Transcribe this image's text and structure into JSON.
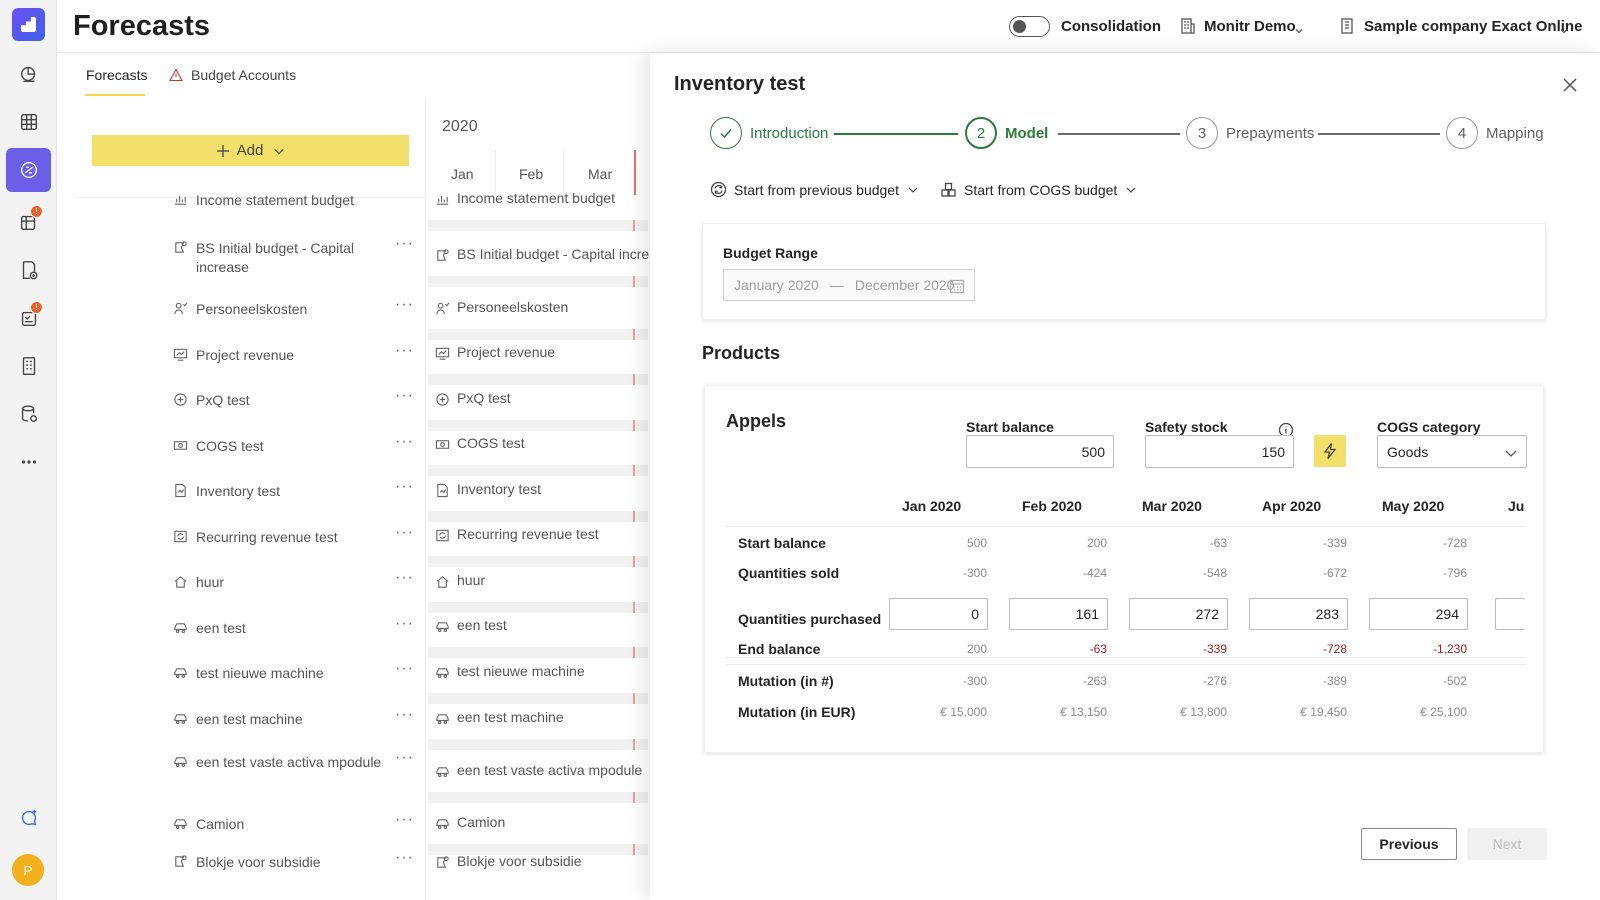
{
  "header": {
    "title": "Forecasts",
    "consolidation_label": "Consolidation",
    "org_label": "Monitr Demo",
    "company_label": "Sample company Exact Online"
  },
  "rail": {
    "avatar_initial": "P",
    "icons": [
      "dashboard-icon",
      "grid-icon",
      "forecast-icon",
      "budget-sheet-icon",
      "report-add-icon",
      "tasks-icon",
      "building-icon",
      "database-icon",
      "more-icon",
      "chat-sparkle-icon"
    ]
  },
  "tabs": {
    "forecasts": "Forecasts",
    "budget_accounts": "Budget Accounts"
  },
  "add_label": "Add",
  "grid": {
    "year": "2020",
    "months": [
      "Jan",
      "Feb",
      "Mar"
    ]
  },
  "forecast_list": [
    "Income statement budget",
    "BS Initial budget - Capital increase",
    "Personeelskosten",
    "Project revenue",
    "PxQ test",
    "COGS test",
    "Inventory test",
    "Recurring revenue test",
    "huur",
    "een test",
    "test nieuwe machine",
    "een test machine",
    "een test vaste activa mpodule",
    "Camion",
    "Blokje voor subsidie"
  ],
  "grid_rows": [
    "Income statement budget",
    "BS Initial budget - Capital increa",
    "Personeelskosten",
    "Project revenue",
    "PxQ test",
    "COGS test",
    "Inventory test",
    "Recurring revenue test",
    "huur",
    "een test",
    "test nieuwe machine",
    "een test machine",
    "een test vaste activa mpodule",
    "Camion",
    "Blokje voor subsidie"
  ],
  "panel": {
    "title": "Inventory test",
    "steps": [
      {
        "num": "1",
        "label": "Introduction",
        "state": "done"
      },
      {
        "num": "2",
        "label": "Model",
        "state": "current"
      },
      {
        "num": "3",
        "label": "Prepayments",
        "state": "todo"
      },
      {
        "num": "4",
        "label": "Mapping",
        "state": "todo"
      }
    ],
    "start_prev_label": "Start from previous budget",
    "start_cogs_label": "Start from COGS budget",
    "budget_range_label": "Budget Range",
    "range_start": "January 2020",
    "range_sep": "—",
    "range_end": "December 2020",
    "products_title": "Products",
    "product": {
      "name": "Appels",
      "start_balance_label": "Start balance",
      "start_balance": "500",
      "safety_stock_label": "Safety stock",
      "safety_stock": "150",
      "cogs_label": "COGS category",
      "cogs_value": "Goods",
      "months": [
        "Jan 2020",
        "Feb 2020",
        "Mar 2020",
        "Apr 2020",
        "May 2020",
        "Ju"
      ],
      "rows": {
        "start_balance": {
          "label": "Start balance",
          "values": [
            "500",
            "200",
            "-63",
            "-339",
            "-728"
          ]
        },
        "quantities_sold": {
          "label": "Quantities sold",
          "values": [
            "-300",
            "-424",
            "-548",
            "-672",
            "-796"
          ]
        },
        "quantities_purchased": {
          "label": "Quantities purchased",
          "values": [
            "0",
            "161",
            "272",
            "283",
            "294"
          ]
        },
        "end_balance": {
          "label": "End balance",
          "values": [
            "200",
            "-63",
            "-339",
            "-728",
            "-1,230"
          ]
        },
        "mutation_qty": {
          "label": "Mutation (in #)",
          "values": [
            "-300",
            "-263",
            "-276",
            "-389",
            "-502"
          ]
        },
        "mutation_eur": {
          "label": "Mutation (in EUR)",
          "values": [
            "€ 15,000",
            "€ 13,150",
            "€ 13,800",
            "€ 19,450",
            "€ 25,100"
          ]
        }
      }
    },
    "previous_label": "Previous",
    "next_label": "Next"
  },
  "colors": {
    "accent_yellow": "#f3e06a",
    "step_green": "#2c7a3d",
    "rail_active": "#6b5fe7",
    "negative_red": "#9c2020"
  }
}
